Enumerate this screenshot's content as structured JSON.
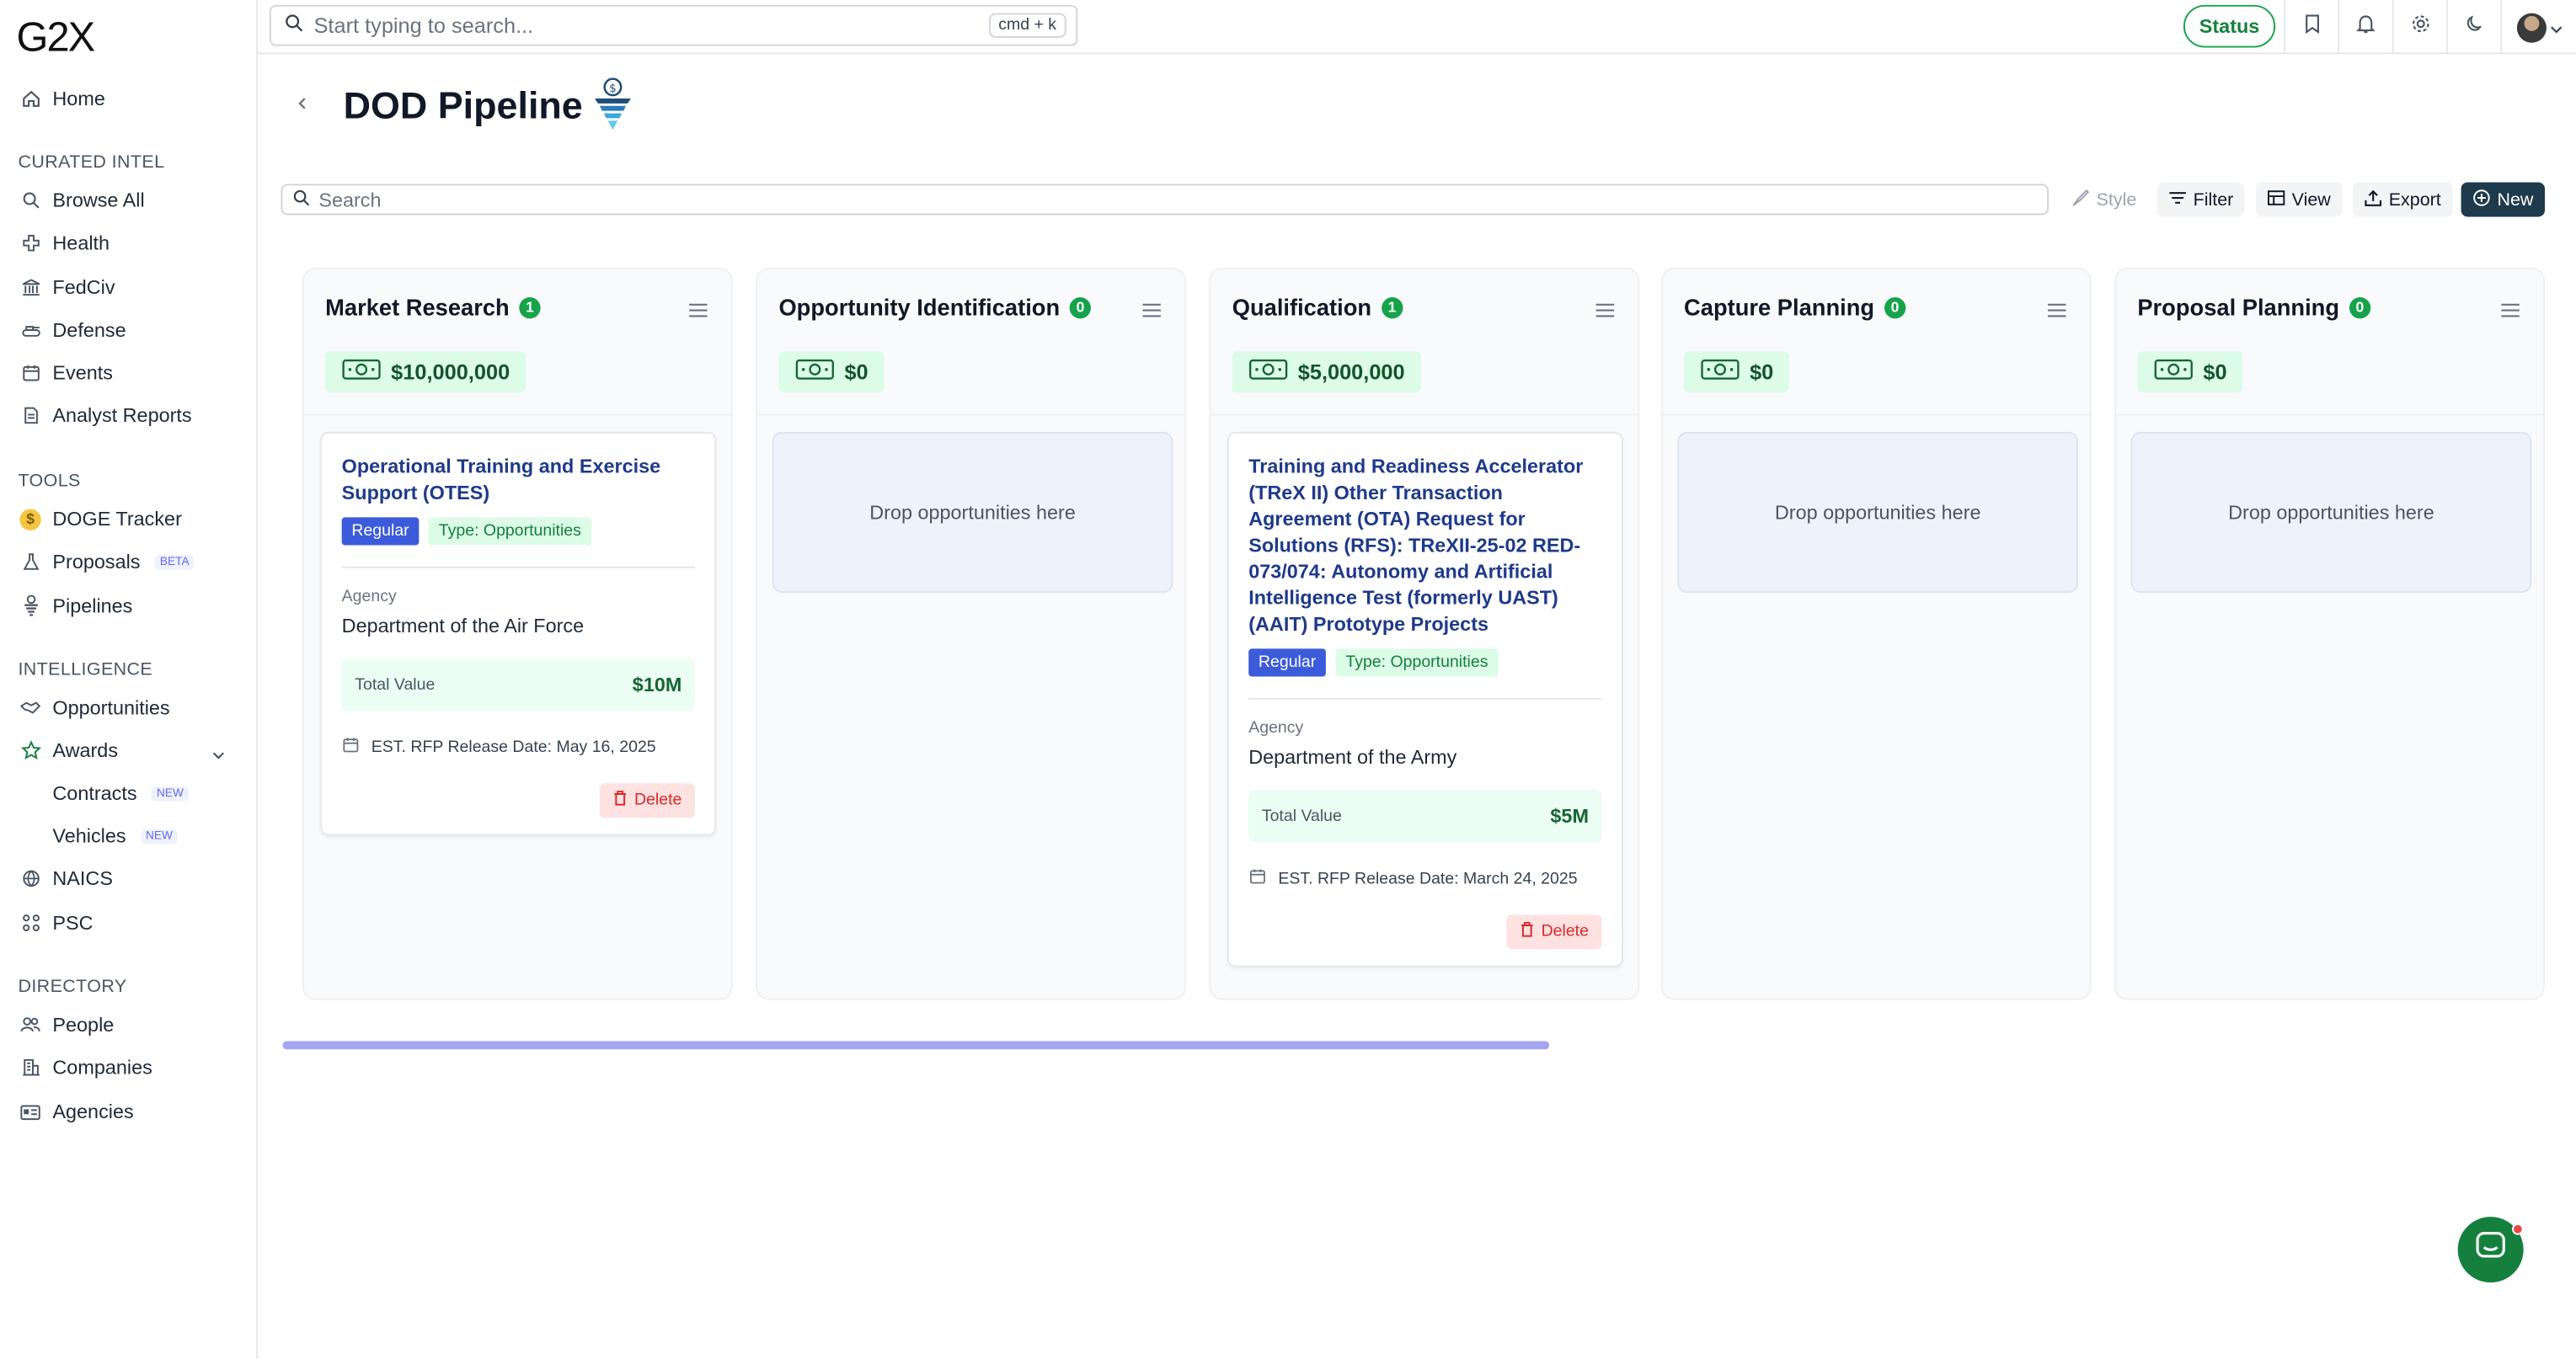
{
  "app": {
    "logo": "G2X"
  },
  "topbar": {
    "search_placeholder": "Start typing to search...",
    "shortcut": "cmd + k",
    "status_label": "Status"
  },
  "sidebar": {
    "home": "Home",
    "curated_label": "CURATED INTEL",
    "curated": [
      "Browse All",
      "Health",
      "FedCiv",
      "Defense",
      "Events",
      "Analyst Reports"
    ],
    "tools_label": "TOOLS",
    "tools": {
      "doge": "DOGE Tracker",
      "proposals": "Proposals",
      "proposals_badge": "BETA",
      "pipelines": "Pipelines"
    },
    "intel_label": "INTELLIGENCE",
    "intel": {
      "opportunities": "Opportunities",
      "awards": "Awards",
      "contracts": "Contracts",
      "vehicles": "Vehicles",
      "new_badge": "NEW",
      "naics": "NAICS",
      "psc": "PSC"
    },
    "directory_label": "DIRECTORY",
    "directory": [
      "People",
      "Companies",
      "Agencies"
    ]
  },
  "page": {
    "title": "DOD Pipeline",
    "search_placeholder": "Search",
    "actions": {
      "style": "Style",
      "filter": "Filter",
      "view": "View",
      "export": "Export",
      "new": "New"
    }
  },
  "columns": [
    {
      "name": "Market Research",
      "count": "1",
      "value": "$10,000,000"
    },
    {
      "name": "Opportunity Identification",
      "count": "0",
      "value": "$0"
    },
    {
      "name": "Qualification",
      "count": "1",
      "value": "$5,000,000"
    },
    {
      "name": "Capture Planning",
      "count": "0",
      "value": "$0"
    },
    {
      "name": "Proposal Planning",
      "count": "0",
      "value": "$0"
    }
  ],
  "dropzone_text": "Drop opportunities here",
  "cards": [
    {
      "title": "Operational Training and Exercise Support (OTES)",
      "tag_regular": "Regular",
      "tag_type": "Type: Opportunities",
      "agency_label": "Agency",
      "agency": "Department of the Air Force",
      "total_value_label": "Total Value",
      "total_value": "$10M",
      "rfp": "EST. RFP Release Date: May 16, 2025",
      "delete": "Delete"
    },
    {
      "title": "Training and Readiness Accelerator (TReX II) Other Transaction Agreement (OTA) Request for Solutions (RFS): TReXII-25-02 RED-073/074: Autonomy and Artificial Intelligence Test (formerly UAST) (AAIT) Prototype Projects",
      "tag_regular": "Regular",
      "tag_type": "Type: Opportunities",
      "agency_label": "Agency",
      "agency": "Department of the Army",
      "total_value_label": "Total Value",
      "total_value": "$5M",
      "rfp": "EST. RFP Release Date: March 24, 2025",
      "delete": "Delete"
    }
  ],
  "colors": {
    "accent_green": "#16a34a",
    "brand_dark": "#1e3a4c",
    "regular_tag": "#3b5bdb",
    "scrollbar": "#a5a6f0"
  }
}
